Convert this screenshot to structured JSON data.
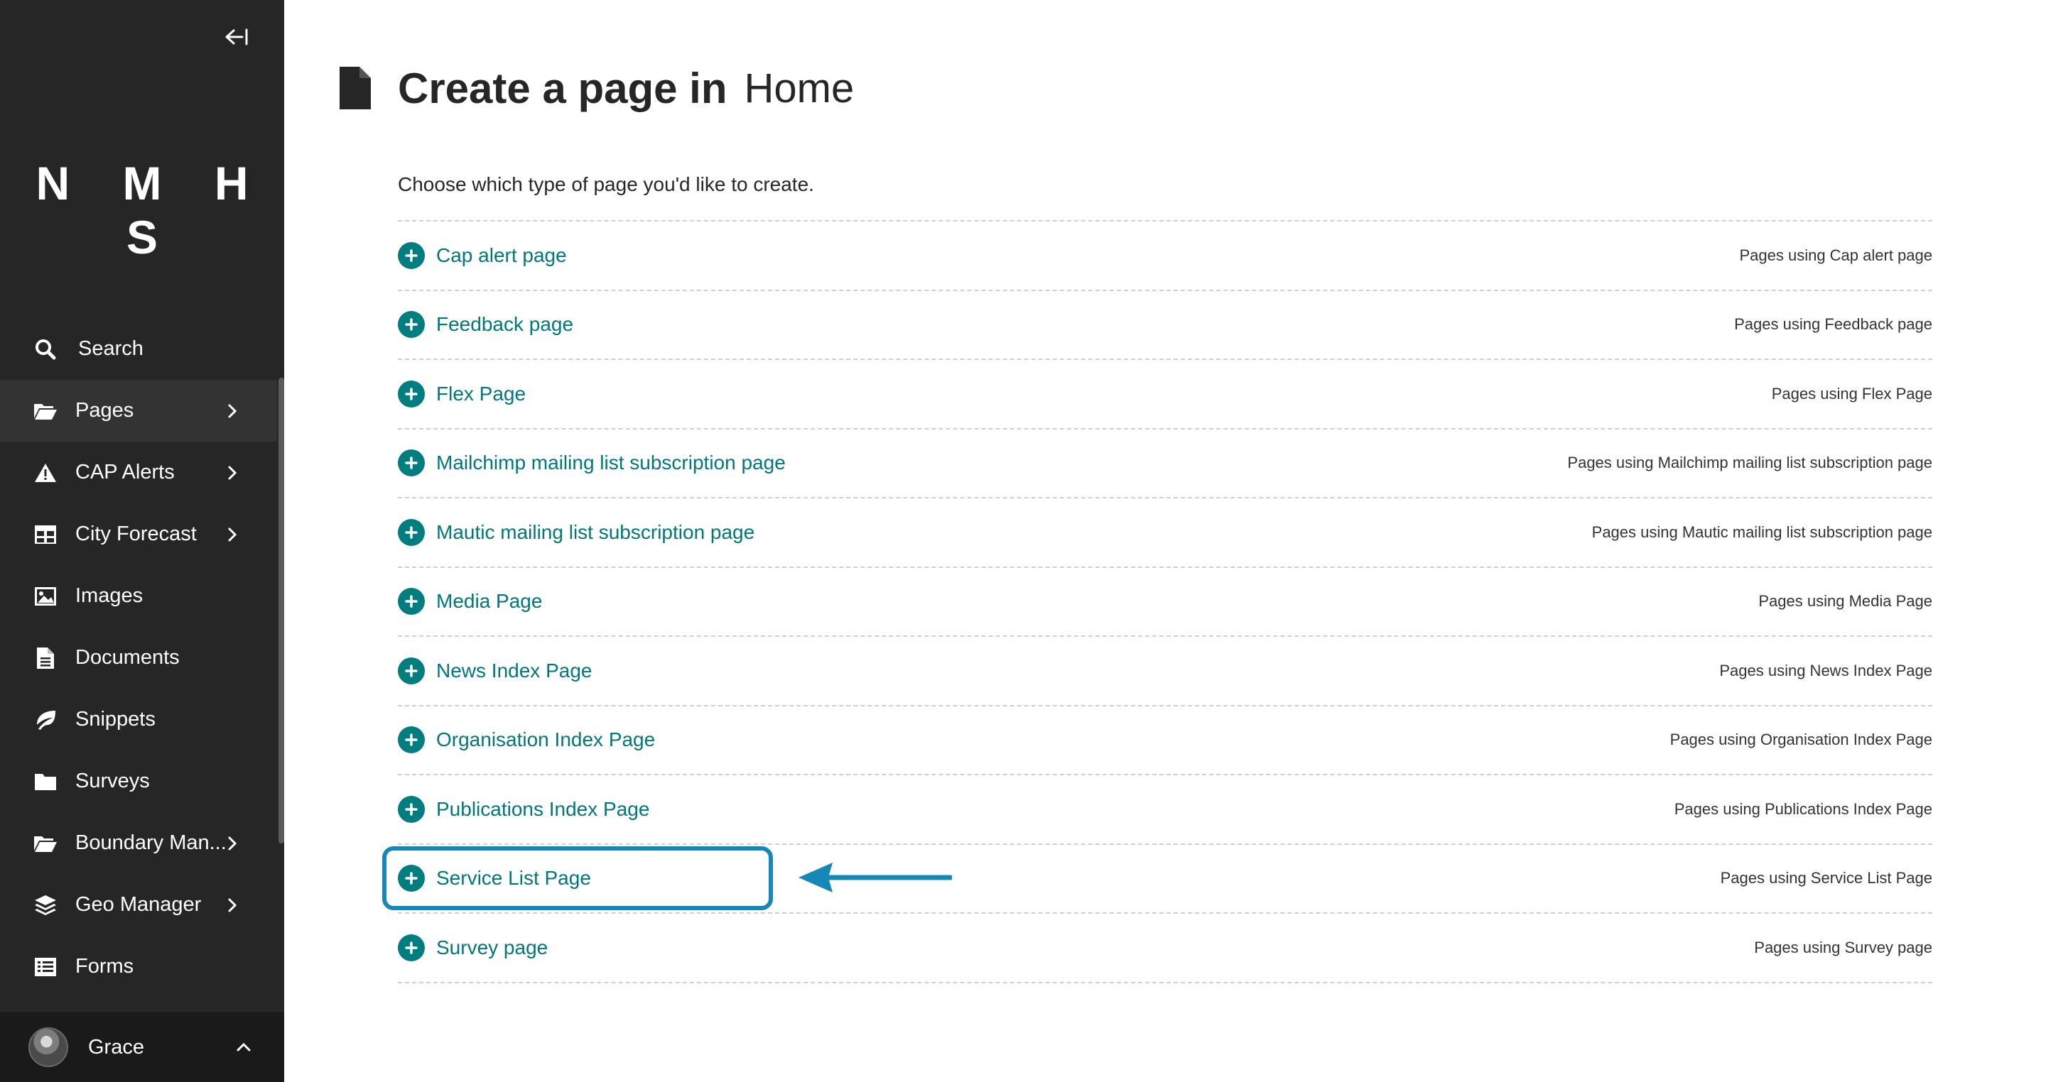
{
  "sidebar": {
    "logo": "N M H S",
    "items": [
      {
        "label": "Search",
        "icon": "search-icon"
      },
      {
        "label": "Pages",
        "icon": "folder-open-icon"
      },
      {
        "label": "CAP Alerts",
        "icon": "warning-icon"
      },
      {
        "label": "City Forecast",
        "icon": "table-icon"
      },
      {
        "label": "Images",
        "icon": "image-icon"
      },
      {
        "label": "Documents",
        "icon": "document-icon"
      },
      {
        "label": "Snippets",
        "icon": "snippet-icon"
      },
      {
        "label": "Surveys",
        "icon": "folder-icon"
      },
      {
        "label": "Boundary Man...",
        "icon": "folder-open-icon"
      },
      {
        "label": "Geo Manager",
        "icon": "layers-icon"
      },
      {
        "label": "Forms",
        "icon": "list-icon"
      }
    ],
    "account": {
      "name": "Grace"
    }
  },
  "header": {
    "title": "Create a page in",
    "location": "Home"
  },
  "intro": "Choose which type of page you'd like to create.",
  "page_types": [
    {
      "label": "Cap alert page",
      "usage": "Pages using Cap alert page"
    },
    {
      "label": "Feedback page",
      "usage": "Pages using Feedback page"
    },
    {
      "label": "Flex Page",
      "usage": "Pages using Flex Page"
    },
    {
      "label": "Mailchimp mailing list subscription page",
      "usage": "Pages using Mailchimp mailing list subscription page"
    },
    {
      "label": "Mautic mailing list subscription page",
      "usage": "Pages using Mautic mailing list subscription page"
    },
    {
      "label": "Media Page",
      "usage": "Pages using Media Page"
    },
    {
      "label": "News Index Page",
      "usage": "Pages using News Index Page"
    },
    {
      "label": "Organisation Index Page",
      "usage": "Pages using Organisation Index Page"
    },
    {
      "label": "Publications Index Page",
      "usage": "Pages using Publications Index Page"
    },
    {
      "label": "Service List Page",
      "usage": "Pages using Service List Page"
    },
    {
      "label": "Survey page",
      "usage": "Pages using Survey page"
    }
  ],
  "colors": {
    "sidebar_bg": "#262626",
    "accent_teal": "#007d7e",
    "highlight_blue": "#1588b8"
  }
}
